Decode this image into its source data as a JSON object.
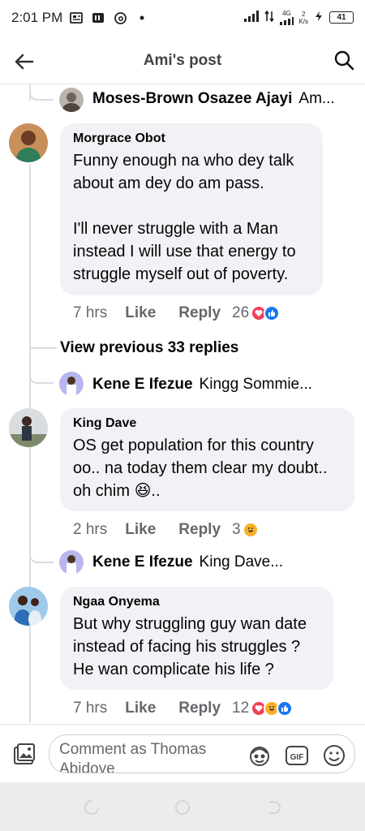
{
  "status_bar": {
    "time": "2:01 PM",
    "network_label": "4G",
    "speed_value": "2",
    "speed_unit": "K/s",
    "battery": "41"
  },
  "header": {
    "title": "Ami's post",
    "back_icon": "arrow-left-icon",
    "search_icon": "search-icon"
  },
  "thread": {
    "top_reply": {
      "name": "Moses-Brown Osazee Ajayi",
      "text": "Am..."
    },
    "comments": [
      {
        "author": "Morgrace Obot",
        "text": "Funny enough na who dey talk about am dey do am pass.\n\nI'll never struggle with a Man instead I will use that energy to struggle myself out of poverty.",
        "time": "7 hrs",
        "like": "Like",
        "reply": "Reply",
        "reaction_count": "26",
        "reactions": [
          "love",
          "like"
        ]
      },
      {
        "author": "King Dave",
        "text": "OS get population for this country oo.. na today them clear my doubt.. oh chim 😆..",
        "time": "2 hrs",
        "like": "Like",
        "reply": "Reply",
        "reaction_count": "3",
        "reactions": [
          "haha"
        ]
      },
      {
        "author": "Ngaa Onyema",
        "text": "But why struggling guy wan date instead of facing his struggles ? He wan complicate his life ?",
        "time": "7 hrs",
        "like": "Like",
        "reply": "Reply",
        "reaction_count": "12",
        "reactions": [
          "love",
          "haha",
          "like"
        ]
      }
    ],
    "view_previous": "View previous 33 replies",
    "reply_previews": [
      {
        "name": "Kene E Ifezue",
        "text": "Kingg Sommie..."
      },
      {
        "name": "Kene E Ifezue",
        "text": "King Dave..."
      }
    ]
  },
  "composer": {
    "placeholder": "Comment as Thomas Abidoye",
    "gif_label": "GIF",
    "icons": [
      "photo-icon",
      "avatar-sticker-icon",
      "gif-icon",
      "emoji-icon"
    ]
  },
  "colors": {
    "bubble": "#f0f2f5",
    "meta_text": "#65676b",
    "like_blue": "#1877f2",
    "love_red": "#f33e58",
    "haha_yellow": "#f7b125"
  }
}
